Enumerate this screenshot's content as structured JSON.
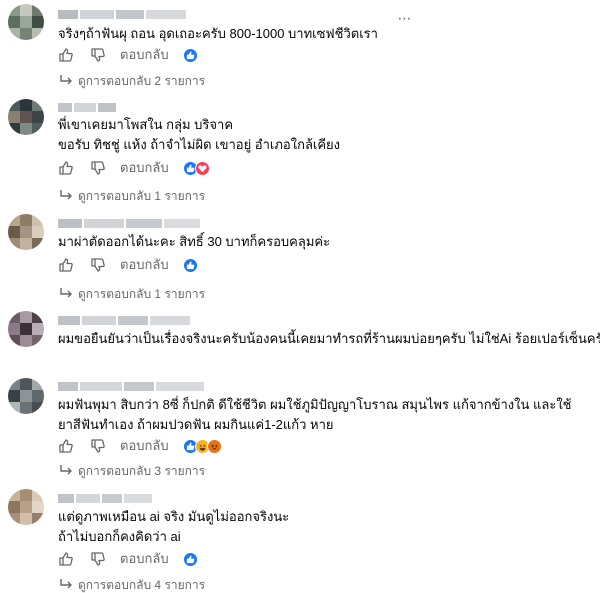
{
  "comments": [
    {
      "text_lines": [
        "จริงๆถ้าฟันผุ ถอน อุดเถอะครับ 800-1000 บาทเซฟชีวิตเรา"
      ],
      "reply_label": "ตอบกลับ",
      "reactions": [
        "like"
      ],
      "replies_text": "ดูการตอบกลับ 2 รายการ",
      "more_label": "⋯"
    },
    {
      "text_lines": [
        "พี่เขาเคยมาโพสใน กลุ่ม บริจาค",
        "ขอรับ ทิชชู่ แห้ง ถ้าจำไม่ผิด เขาอยู่ อำเภอใกล้เคียง"
      ],
      "reply_label": "ตอบกลับ",
      "reactions": [
        "like",
        "love"
      ],
      "replies_text": "ดูการตอบกลับ 1 รายการ"
    },
    {
      "text_lines": [
        "มาผ่าตัดออกได้นะคะ สิทธิ์ 30 บาทก็ครอบคลุมค่ะ"
      ],
      "reply_label": "ตอบกลับ",
      "reactions": [
        "like"
      ],
      "replies_text": "ดูการตอบกลับ 1 รายการ"
    },
    {
      "text_lines": [
        "ผมขอยืนยันว่าเป็นเรื่องจริงนะครับน้องคนนี้เคยมาทำรถที่ร้านผมบ่อยๆครับ ไม่ใช่Ai ร้อยเปอร์เซ็นครับ"
      ],
      "reply_label": "ตอบกลับ",
      "reactions": [
        "like"
      ],
      "replies_text": ""
    },
    {
      "text_lines": [
        "ผมฟันพุมา สิบกว่า 8ซี่ ก็ปกติ ดีใช้ชีวิต ผมใช้ภูมิปัญญาโบราณ สมุนไพร แก้จากข้างใน และใช้",
        "ยาสีฟันทำเอง ถ้าผมปวดฟัน ผมกินแค่1-2แก้ว หาย"
      ],
      "reply_label": "ตอบกลับ",
      "reactions": [
        "like",
        "haha",
        "angry"
      ],
      "replies_text": "ดูการตอบกลับ 3 รายการ"
    },
    {
      "text_lines": [
        "แต่ดูภาพเหมือน ai จริง มันดูไม่ออกจริงนะ",
        "ถ้าไม่บอกก็คงคิดว่า ai"
      ],
      "reply_label": "ตอบกลับ",
      "reactions": [
        "like"
      ],
      "replies_text": "ดูการตอบกลับ 4 รายการ"
    }
  ],
  "colors": {
    "text": "#050505",
    "secondary": "#65676b",
    "like_blue": "#1877f2",
    "love_red": "#f33e58",
    "haha_yellow": "#f7b125",
    "angry_orange": "#e9710f"
  }
}
